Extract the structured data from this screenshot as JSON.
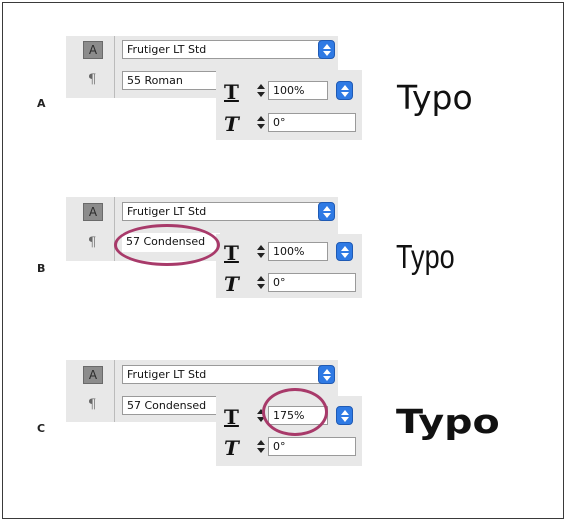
{
  "examples": [
    {
      "label": "A",
      "font_family": "Frutiger LT Std",
      "font_style": "55 Roman",
      "scale": "100%",
      "skew": "0°",
      "preview": "Typo"
    },
    {
      "label": "B",
      "font_family": "Frutiger LT Std",
      "font_style": "57 Condensed",
      "scale": "100%",
      "skew": "0°",
      "preview": "Typo"
    },
    {
      "label": "C",
      "font_family": "Frutiger LT Std",
      "font_style": "57 Condensed",
      "scale": "175%",
      "skew": "0°",
      "preview": "Typo"
    }
  ],
  "icons": {
    "char_button": "A",
    "paragraph": "¶",
    "vertical_scale": "T",
    "skew": "T"
  },
  "colors": {
    "dropdown_blue": "#2f7ae4",
    "highlight_circle": "#a83a6a"
  }
}
